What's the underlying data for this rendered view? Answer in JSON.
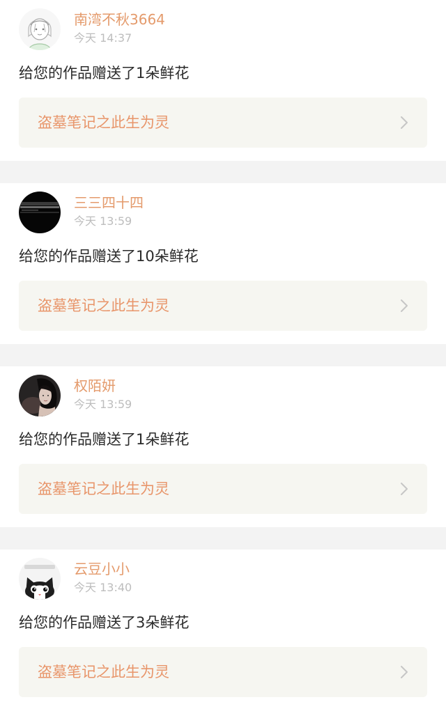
{
  "notifications": [
    {
      "username": "南湾不秋3664",
      "time": "今天 14:37",
      "message": "给您的作品赠送了1朵鲜花",
      "work_title": "盗墓笔记之此生为灵",
      "avatar_icon": "sketch-girl-avatar"
    },
    {
      "username": "三三四十四",
      "time": "今天 13:59",
      "message": "给您的作品赠送了10朵鲜花",
      "work_title": "盗墓笔记之此生为灵",
      "avatar_icon": "dark-screen-avatar"
    },
    {
      "username": "权陌妍",
      "time": "今天 13:59",
      "message": "给您的作品赠送了1朵鲜花",
      "work_title": "盗墓笔记之此生为灵",
      "avatar_icon": "dark-portrait-avatar"
    },
    {
      "username": "云豆小小",
      "time": "今天 13:40",
      "message": "给您的作品赠送了3朵鲜花",
      "work_title": "盗墓笔记之此生为灵",
      "avatar_icon": "cartoon-cat-avatar"
    }
  ],
  "colors": {
    "username": "#e49a6b",
    "work_title": "#e8956a",
    "time": "#bdbdbd",
    "message": "#2a2a2a",
    "link_background": "#f6f6f1",
    "divider": "#f3f3f3"
  }
}
